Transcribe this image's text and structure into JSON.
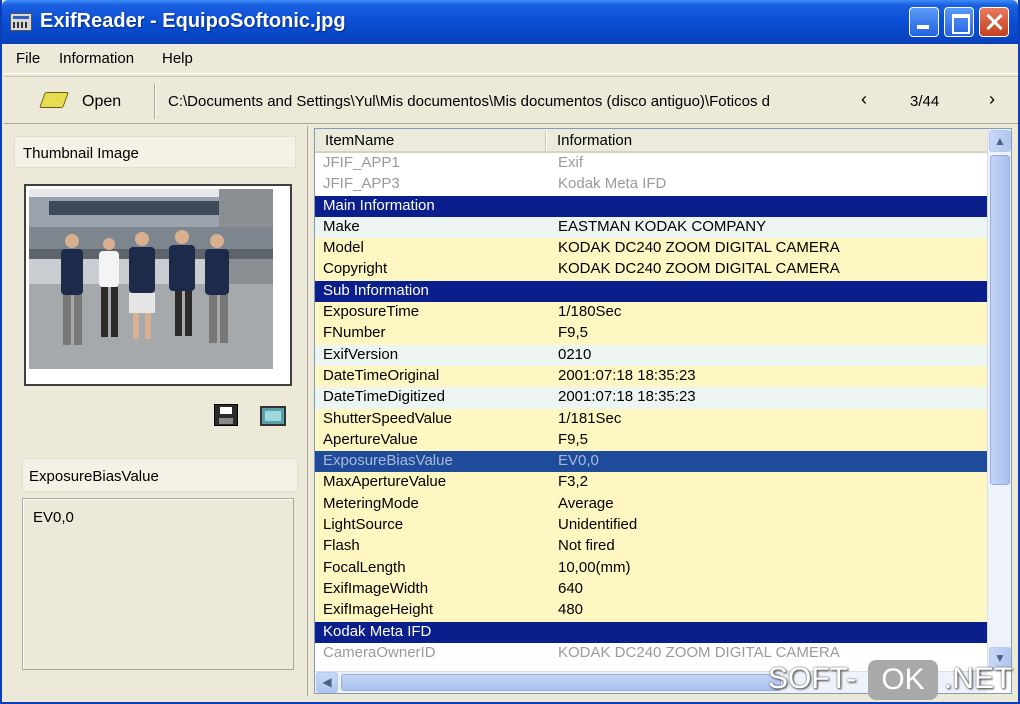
{
  "window": {
    "title": "ExifReader - EquipoSoftonic.jpg"
  },
  "menu": {
    "file": "File",
    "information": "Information",
    "help": "Help"
  },
  "toolbar": {
    "open_label": "Open",
    "path": "C:\\Documents and Settings\\Yul\\Mis documentos\\Mis documentos (disco antiguo)\\Foticos d",
    "prev": "‹",
    "next": "›",
    "page_count": "3/44"
  },
  "left": {
    "thumbnail_header": "Thumbnail Image",
    "selected_item_name": "ExposureBiasValue",
    "selected_item_value": "EV0,0"
  },
  "table": {
    "col_item": "ItemName",
    "col_info": "Information",
    "rows": [
      {
        "type": "gray",
        "name": "JFIF_APP1",
        "value": "Exif"
      },
      {
        "type": "gray",
        "name": "JFIF_APP3",
        "value": "Kodak Meta IFD"
      },
      {
        "type": "header",
        "name": "Main Information",
        "value": ""
      },
      {
        "type": "light",
        "name": "Make",
        "value": "EASTMAN KODAK COMPANY"
      },
      {
        "type": "yellow",
        "name": "Model",
        "value": "KODAK DC240 ZOOM DIGITAL CAMERA"
      },
      {
        "type": "yellow",
        "name": "Copyright",
        "value": "KODAK DC240 ZOOM DIGITAL CAMERA"
      },
      {
        "type": "header",
        "name": "Sub Information",
        "value": ""
      },
      {
        "type": "yellow",
        "name": "ExposureTime",
        "value": "1/180Sec"
      },
      {
        "type": "yellow",
        "name": "FNumber",
        "value": "F9,5"
      },
      {
        "type": "light",
        "name": "ExifVersion",
        "value": "0210"
      },
      {
        "type": "yellow",
        "name": "DateTimeOriginal",
        "value": "2001:07:18 18:35:23"
      },
      {
        "type": "light",
        "name": "DateTimeDigitized",
        "value": "2001:07:18 18:35:23"
      },
      {
        "type": "yellow",
        "name": "ShutterSpeedValue",
        "value": "1/181Sec"
      },
      {
        "type": "yellow",
        "name": "ApertureValue",
        "value": "F9,5"
      },
      {
        "type": "selected",
        "name": "ExposureBiasValue",
        "value": "EV0,0"
      },
      {
        "type": "yellow",
        "name": "MaxApertureValue",
        "value": "F3,2"
      },
      {
        "type": "yellow",
        "name": "MeteringMode",
        "value": "Average"
      },
      {
        "type": "yellow",
        "name": "LightSource",
        "value": "Unidentified"
      },
      {
        "type": "yellow",
        "name": "Flash",
        "value": "Not fired"
      },
      {
        "type": "yellow",
        "name": "FocalLength",
        "value": "10,00(mm)"
      },
      {
        "type": "yellow",
        "name": "ExifImageWidth",
        "value": "640"
      },
      {
        "type": "yellow",
        "name": "ExifImageHeight",
        "value": "480"
      },
      {
        "type": "header",
        "name": "Kodak Meta IFD",
        "value": ""
      },
      {
        "type": "gray",
        "name": "CameraOwnerID",
        "value": "KODAK DC240 ZOOM DIGITAL CAMERA"
      }
    ]
  },
  "watermark": {
    "part1": "SOFT-",
    "part2": "OK",
    "part3": ".NET"
  }
}
